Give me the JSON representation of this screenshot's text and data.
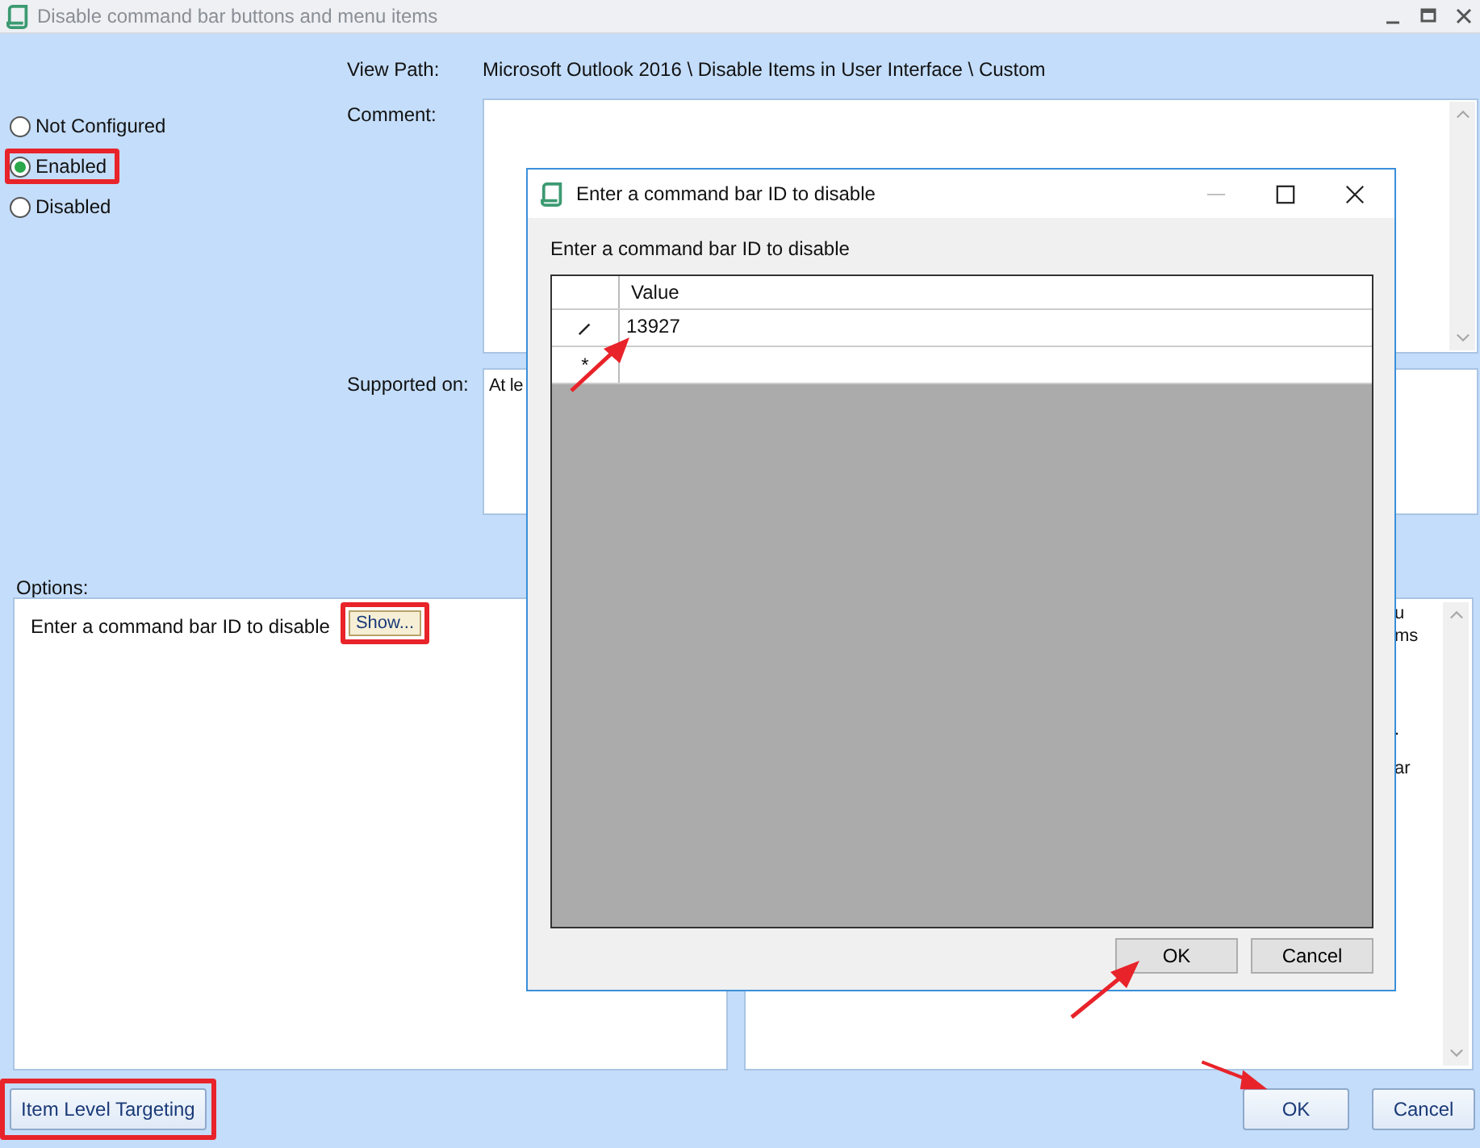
{
  "window": {
    "title": "Disable command bar buttons and menu items"
  },
  "state_options": [
    {
      "label": "Not Configured",
      "selected": false,
      "highlighted": false
    },
    {
      "label": "Enabled",
      "selected": true,
      "highlighted": true
    },
    {
      "label": "Disabled",
      "selected": false,
      "highlighted": false
    }
  ],
  "view_path": {
    "label": "View Path:",
    "value": "Microsoft Outlook 2016 \\ Disable Items in User Interface \\ Custom"
  },
  "comment": {
    "label": "Comment:"
  },
  "supported_on": {
    "label": "Supported on:",
    "value": "At le"
  },
  "options": {
    "label": "Options:",
    "prompt": "Enter a command bar ID to disable",
    "button": "Show...",
    "button_highlighted": true
  },
  "help_text": [
    "u",
    "ms",
    ".",
    "ar"
  ],
  "footer_buttons": [
    {
      "label": "Item Level Targeting",
      "highlighted": true
    },
    {
      "label": "OK",
      "highlighted": false
    },
    {
      "label": "Cancel",
      "highlighted": false
    }
  ],
  "dialog": {
    "title": "Enter a command bar ID to disable",
    "prompt": "Enter a command bar ID to disable",
    "column": "Value",
    "rows": [
      {
        "kind": "editing",
        "value": "13927"
      },
      {
        "kind": "new",
        "marker": "*"
      }
    ],
    "buttons": [
      "OK",
      "Cancel"
    ]
  }
}
